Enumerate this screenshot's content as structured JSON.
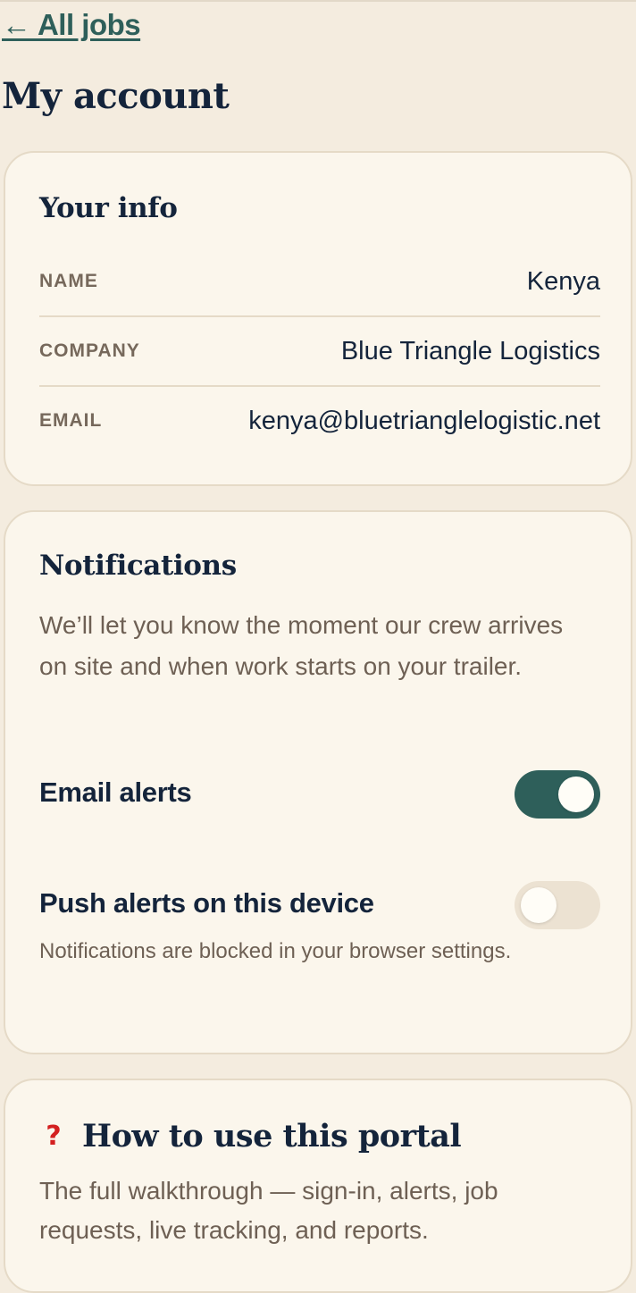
{
  "nav": {
    "back_label": "← All jobs"
  },
  "page": {
    "title": "My account"
  },
  "your_info": {
    "title": "Your info",
    "rows": [
      {
        "label": "NAME",
        "value": "Kenya"
      },
      {
        "label": "COMPANY",
        "value": "Blue Triangle Logistics"
      },
      {
        "label": "EMAIL",
        "value": "kenya@bluetrianglelogistic.net"
      }
    ]
  },
  "notifications": {
    "title": "Notifications",
    "description": "We’ll let you know the moment our crew arrives on site and when work starts on your trailer.",
    "email_alerts": {
      "label": "Email alerts",
      "enabled": true
    },
    "push_alerts": {
      "label": "Push alerts on this device",
      "enabled": false,
      "note": "Notifications are blocked in your browser settings."
    }
  },
  "help": {
    "icon": "question-mark-icon",
    "icon_glyph": "?",
    "title": "How to use this portal",
    "description": "The full walkthrough — sign-in, alerts, job requests, live tracking, and reports."
  },
  "colors": {
    "background": "#f4ecdf",
    "card": "#fbf6ec",
    "accent": "#2e5f5a",
    "heading": "#14243b",
    "muted": "#6e6054",
    "help_icon": "#d42020"
  }
}
